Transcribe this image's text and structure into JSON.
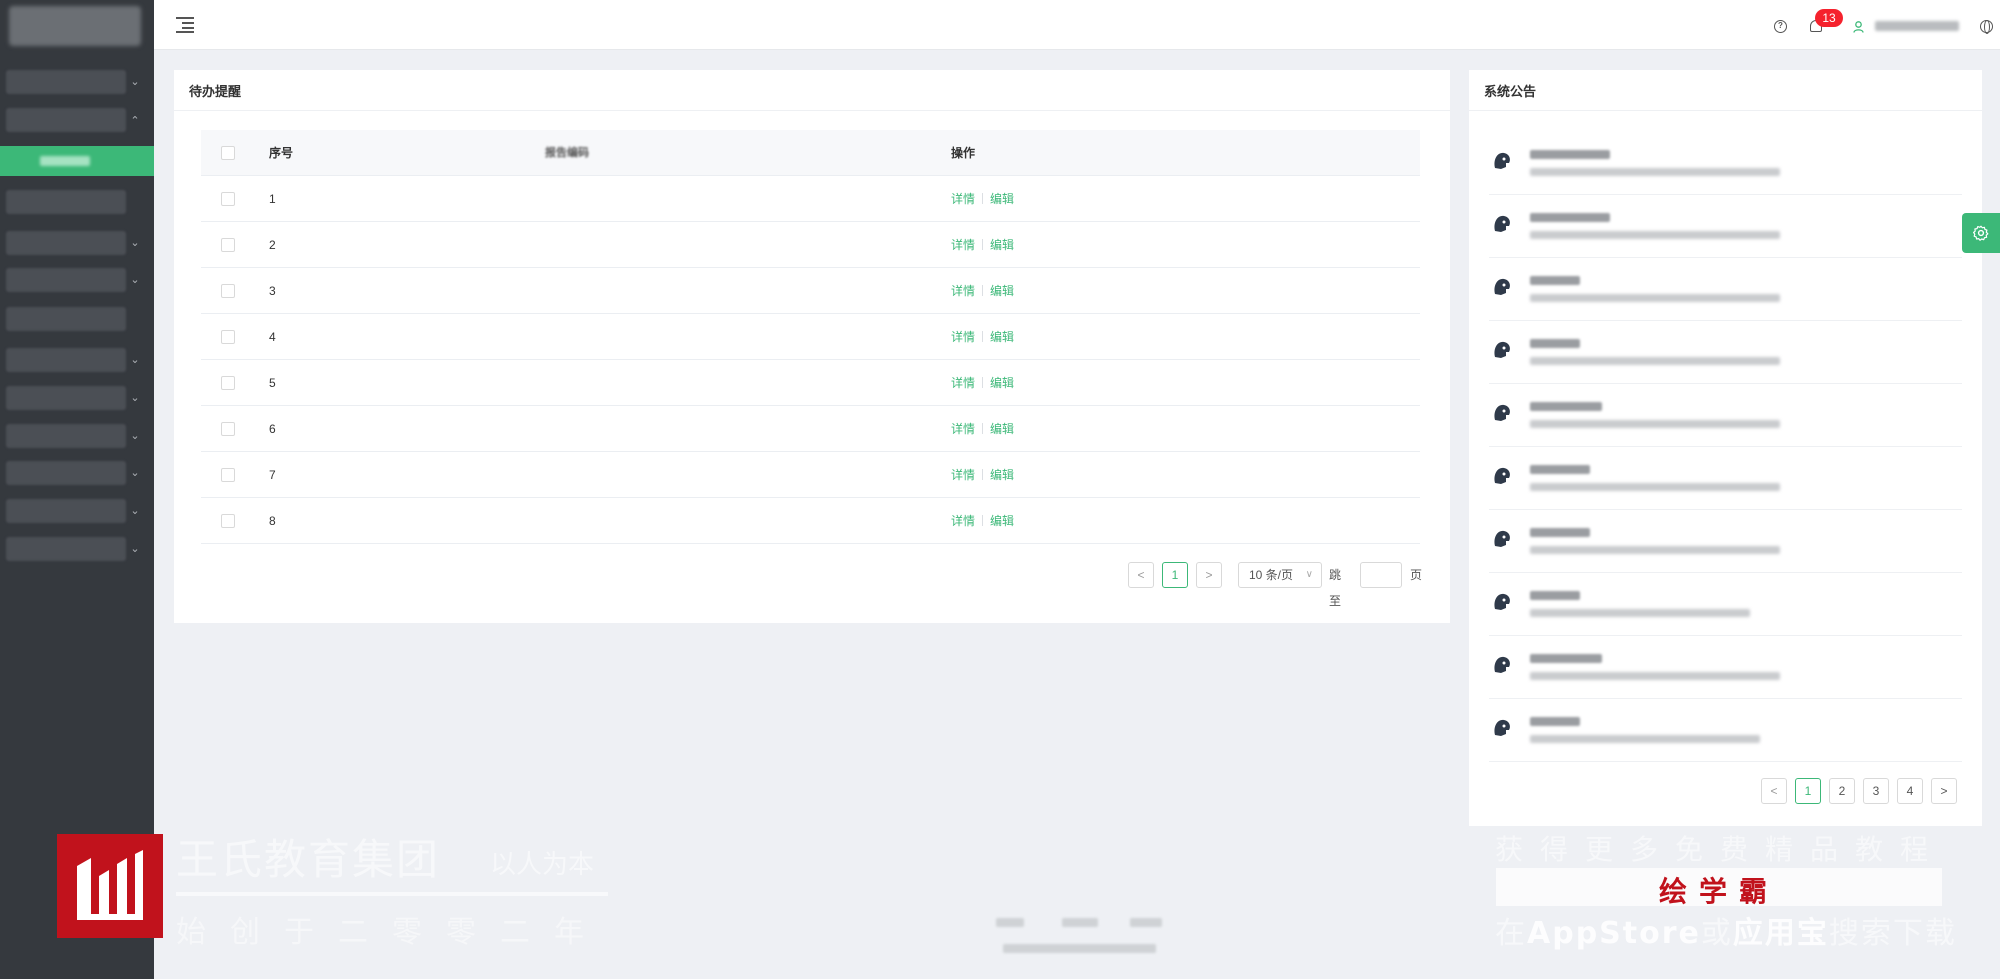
{
  "header": {
    "notification_count": "13"
  },
  "todo": {
    "title": "待办提醒",
    "columns": {
      "no": "序号",
      "code": "报告编码",
      "op": "操作"
    },
    "rows": [
      {
        "no": "1",
        "detail": "详情",
        "edit": "编辑"
      },
      {
        "no": "2",
        "detail": "详情",
        "edit": "编辑"
      },
      {
        "no": "3",
        "detail": "详情",
        "edit": "编辑"
      },
      {
        "no": "4",
        "detail": "详情",
        "edit": "编辑"
      },
      {
        "no": "5",
        "detail": "详情",
        "edit": "编辑"
      },
      {
        "no": "6",
        "detail": "详情",
        "edit": "编辑"
      },
      {
        "no": "7",
        "detail": "详情",
        "edit": "编辑"
      },
      {
        "no": "8",
        "detail": "详情",
        "edit": "编辑"
      }
    ],
    "pager": {
      "prev": "<",
      "current": "1",
      "next": ">",
      "page_size": "10 条/页",
      "jump_label": "跳至",
      "page_label": "页"
    }
  },
  "notice": {
    "title": "系统公告",
    "pager": {
      "prev": "<",
      "pages": [
        "1",
        "2",
        "3",
        "4"
      ],
      "next": ">"
    }
  },
  "watermark": {
    "left_title": "王氏教育集团",
    "left_sub": "以人为本",
    "left_bottom": "始创于二零零二年",
    "right_top": "获得更多免费精品教程",
    "right_band": "绘学霸",
    "right_bottom_pre": "在",
    "right_bottom_app": "AppStore",
    "right_bottom_mid": "或",
    "right_bottom_bold": "应用宝",
    "right_bottom_post": "搜索下载"
  },
  "colors": {
    "accent": "#3cb878",
    "sidebar": "#35393e",
    "badge": "#f5222d"
  }
}
